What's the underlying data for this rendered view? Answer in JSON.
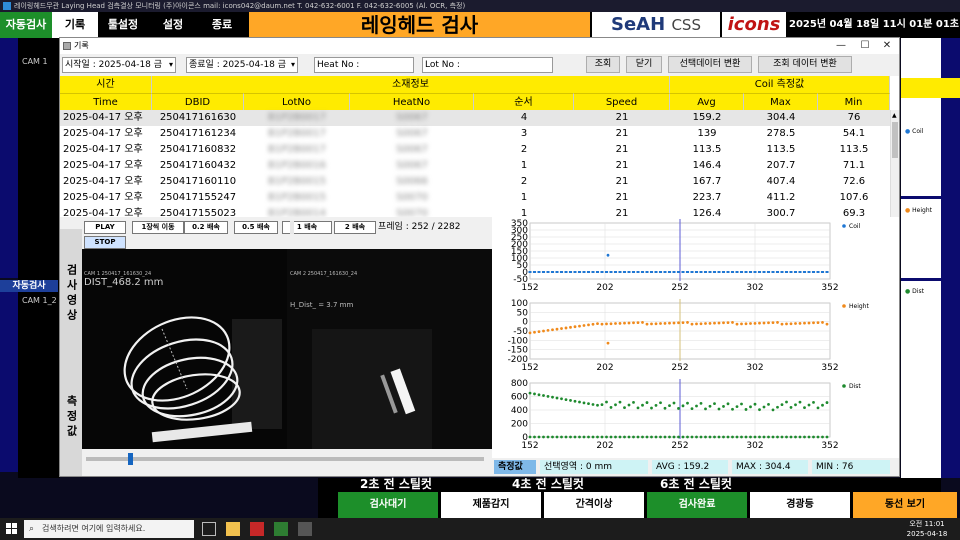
{
  "titlebar": {
    "text": "레이링헤드무관 Laying Head 검측결상 모니터링 (주)아이콘스 mail: icons042@daum.net T. 042-632-6001 F. 042-632-6005 (Al. OCR, 측정)"
  },
  "menu": {
    "auto": "자동검사",
    "items": [
      "기록",
      "툴설정",
      "설정",
      "종료"
    ],
    "title": "레잉헤드 검사",
    "seah": "SeAH",
    "seah_css": "CSS",
    "icons": "icons",
    "datetime": "2025년 04월 18일 11시 01분 01초"
  },
  "dialog": {
    "title": "기록",
    "start_date": "시작일 : 2025-04-18 금",
    "end_date": "종료일 : 2025-04-18 금",
    "heat_no_label": "Heat No :",
    "lot_no_label": "Lot No :",
    "buttons": {
      "search": "조회",
      "close": "닫기",
      "convert_selected": "선택데이터 변환",
      "convert_query": "조회 데이터 변환"
    }
  },
  "table": {
    "group_headers": [
      "시간",
      "소재정보",
      "Coil 측정값"
    ],
    "columns": [
      "Time",
      "DBID",
      "LotNo",
      "HeatNo",
      "순서",
      "Speed",
      "Avg",
      "Max",
      "Min"
    ],
    "rows": [
      {
        "time": "2025-04-17 오후",
        "dbid": "250417161630",
        "lot": "B1P2B0017",
        "heat": "S0067",
        "seq": "4",
        "speed": "21",
        "avg": "159.2",
        "max": "304.4",
        "min": "76"
      },
      {
        "time": "2025-04-17 오후",
        "dbid": "250417161234",
        "lot": "B1P2B0017",
        "heat": "S0067",
        "seq": "3",
        "speed": "21",
        "avg": "139",
        "max": "278.5",
        "min": "54.1"
      },
      {
        "time": "2025-04-17 오후",
        "dbid": "250417160832",
        "lot": "B1P2B0017",
        "heat": "S0067",
        "seq": "2",
        "speed": "21",
        "avg": "113.5",
        "max": "113.5",
        "min": "113.5"
      },
      {
        "time": "2025-04-17 오후",
        "dbid": "250417160432",
        "lot": "B1P2B0016",
        "heat": "S0067",
        "seq": "1",
        "speed": "21",
        "avg": "146.4",
        "max": "207.7",
        "min": "71.1"
      },
      {
        "time": "2025-04-17 오후",
        "dbid": "250417160110",
        "lot": "B1P2B0015",
        "heat": "S0066",
        "seq": "2",
        "speed": "21",
        "avg": "167.7",
        "max": "407.4",
        "min": "72.6"
      },
      {
        "time": "2025-04-17 오후",
        "dbid": "250417155247",
        "lot": "B1P2B0015",
        "heat": "S0070",
        "seq": "1",
        "speed": "21",
        "avg": "223.7",
        "max": "411.2",
        "min": "107.6"
      },
      {
        "time": "2025-04-17 오후",
        "dbid": "250417155023",
        "lot": "B1P2B0014",
        "heat": "S0070",
        "seq": "1",
        "speed": "21",
        "avg": "126.4",
        "max": "300.7",
        "min": "69.3"
      }
    ]
  },
  "player": {
    "side_video": "검사영상",
    "side_measure": "측정값",
    "buttons": [
      "PLAY",
      "1장씩 이동",
      "0.2 배속",
      "0.5 배속",
      "1 배속",
      "2 배속"
    ],
    "stop": "STOP",
    "frame": "프레임 : 252 / 2282",
    "overlay1": "CAM 1 250417_161630_24",
    "dist_text": "DIST_468.2 mm",
    "overlay2": "CAM 2 250417_161630_24",
    "h_dist": "H_Dist_ = 3.7 mm",
    "slider_pos": 0.14
  },
  "status": {
    "label": "측정값",
    "region": "선택영역 : 0 mm",
    "avg": "AVG : 159.2",
    "max": "MAX : 304.4",
    "min": "MIN : 76"
  },
  "chart_data": [
    {
      "type": "scatter",
      "series": [
        {
          "name": "Coil",
          "color": "#1f77d4"
        }
      ],
      "x_ticks": [
        "152",
        "202",
        "252",
        "302",
        "352"
      ],
      "y_ticks": [
        "350",
        "300",
        "250",
        "200",
        "150",
        "100",
        "50",
        "0",
        "-50"
      ],
      "xlim": [
        152,
        352
      ],
      "ylim": [
        -50,
        350
      ],
      "cursor_x": 252
    },
    {
      "type": "scatter",
      "series": [
        {
          "name": "Height",
          "color": "#f08a1c"
        }
      ],
      "x_ticks": [
        "152",
        "202",
        "252",
        "302",
        "352"
      ],
      "y_ticks": [
        "100",
        "50",
        "0",
        "-50",
        "-100",
        "-150",
        "-200"
      ],
      "xlim": [
        152,
        352
      ],
      "ylim": [
        -200,
        100
      ],
      "cursor_x": 252
    },
    {
      "type": "scatter",
      "series": [
        {
          "name": "Dist",
          "color": "#1e8a2e"
        }
      ],
      "x_ticks": [
        "152",
        "202",
        "252",
        "302",
        "352"
      ],
      "y_ticks": [
        "800",
        "600",
        "400",
        "200",
        "0"
      ],
      "xlim": [
        152,
        352
      ],
      "ylim": [
        0,
        800
      ],
      "cursor_x": 252
    }
  ],
  "bottom": {
    "shots": [
      "2초 전 스틸컷",
      "4초 전 스틸컷",
      "6초 전 스틸컷"
    ],
    "buttons": [
      "검사대기",
      "제품감지",
      "간격이상",
      "검사완료",
      "경광등",
      "동선 보기"
    ]
  },
  "right_legends": [
    "Coil",
    "Height",
    "Dist"
  ],
  "cams": [
    "CAM 1",
    "CAM 1_2"
  ],
  "taskbar": {
    "search_placeholder": "검색하려면 여기에 입력하세요.",
    "time": "오전 11:01",
    "date": "2025-04-18"
  }
}
